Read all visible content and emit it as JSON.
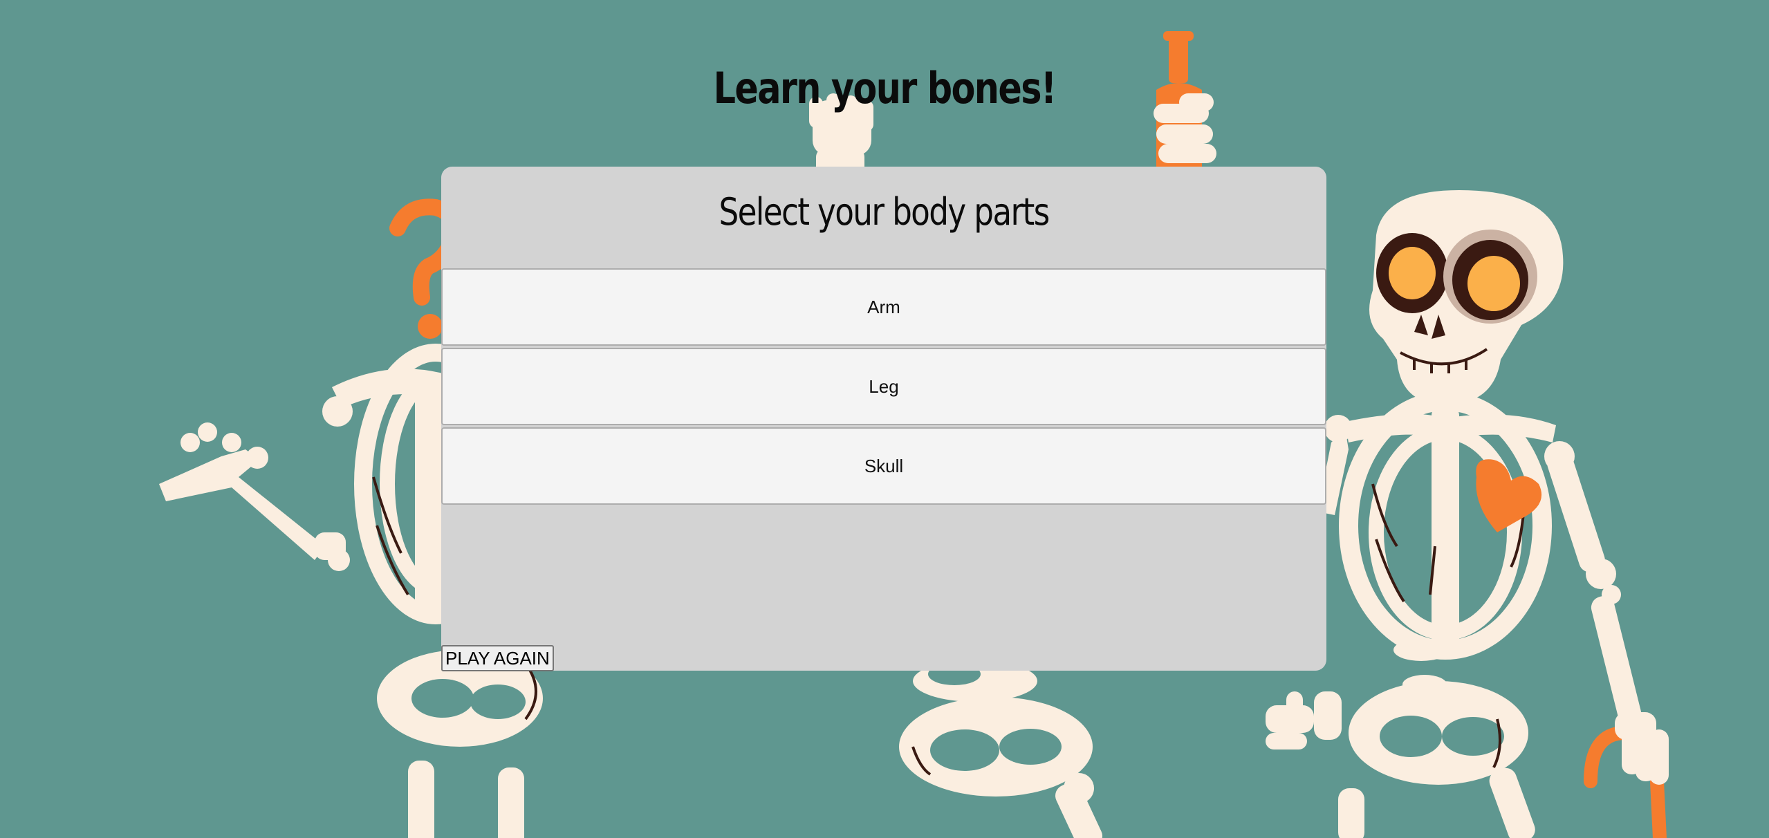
{
  "page": {
    "title": "Learn your bones!"
  },
  "panel": {
    "title": "Select your body parts",
    "options": [
      {
        "label": "Arm"
      },
      {
        "label": "Leg"
      },
      {
        "label": "Skull"
      }
    ],
    "play_again_label": "PLAY AGAIN"
  },
  "colors": {
    "background": "#5f9790",
    "panel": "#d3d3d3",
    "option": "#f4f4f4",
    "bone": "#fbeee0",
    "accent_orange": "#f57c2e"
  },
  "decorations": {
    "illustration": "skeletons",
    "icons": [
      "skeleton-left-illustration",
      "skeleton-center-illustration",
      "skeleton-right-illustration",
      "question-mark-icon",
      "bottle-icon",
      "heart-icon",
      "cane-icon"
    ]
  }
}
